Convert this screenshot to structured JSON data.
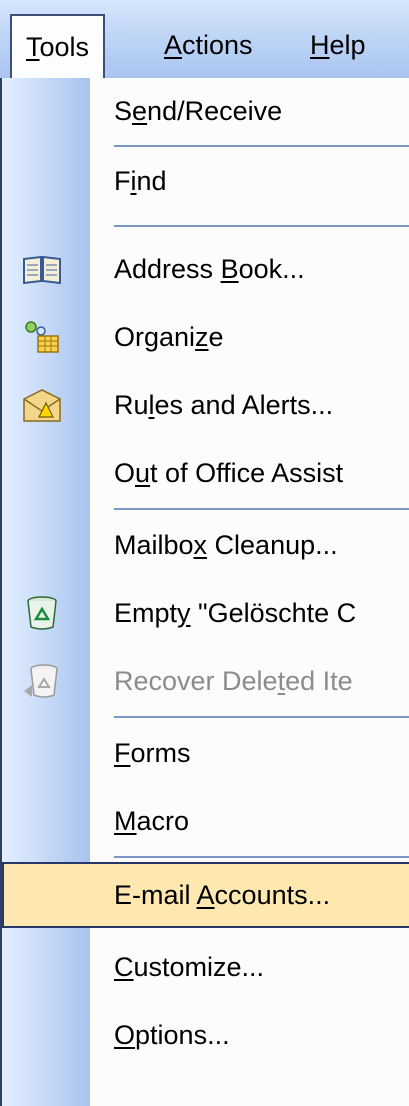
{
  "menubar": [
    {
      "pre": "",
      "u": "T",
      "post": "ools",
      "active": true
    },
    {
      "pre": "",
      "u": "A",
      "post": "ctions",
      "active": false
    },
    {
      "pre": "",
      "u": "H",
      "post": "elp",
      "active": false
    }
  ],
  "menu_items": [
    {
      "pre": "S",
      "u": "e",
      "post": "nd/Receive",
      "icon": null,
      "disabled": false,
      "highlight": false
    },
    {
      "pre": "F",
      "u": "i",
      "post": "nd",
      "icon": null,
      "disabled": false,
      "highlight": false
    },
    {
      "pre": "Address ",
      "u": "B",
      "post": "ook...",
      "icon": "address-book-icon",
      "disabled": false,
      "highlight": false
    },
    {
      "pre": "Organi",
      "u": "z",
      "post": "e",
      "icon": "organize-icon",
      "disabled": false,
      "highlight": false
    },
    {
      "pre": "Ru",
      "u": "l",
      "post": "es and Alerts...",
      "icon": "rules-and-alerts-icon",
      "disabled": false,
      "highlight": false
    },
    {
      "pre": "O",
      "u": "u",
      "post": "t of Office Assist",
      "icon": null,
      "disabled": false,
      "highlight": false
    },
    {
      "pre": "Mailbo",
      "u": "x",
      "post": " Cleanup...",
      "icon": null,
      "disabled": false,
      "highlight": false
    },
    {
      "pre": "Empt",
      "u": "y",
      "post": " \"Gelöschte C",
      "icon": "empty-trash-icon",
      "disabled": false,
      "highlight": false
    },
    {
      "pre": "Recover Dele",
      "u": "t",
      "post": "ed Ite",
      "icon": "recover-deleted-icon",
      "disabled": true,
      "highlight": false
    },
    {
      "pre": "",
      "u": "F",
      "post": "orms",
      "icon": null,
      "disabled": false,
      "highlight": false
    },
    {
      "pre": "",
      "u": "M",
      "post": "acro",
      "icon": null,
      "disabled": false,
      "highlight": false
    },
    {
      "pre": "E-mail ",
      "u": "A",
      "post": "ccounts...",
      "icon": null,
      "disabled": false,
      "highlight": true
    },
    {
      "pre": "",
      "u": "C",
      "post": "ustomize...",
      "icon": null,
      "disabled": false,
      "highlight": false
    },
    {
      "pre": "",
      "u": "O",
      "post": "ptions...",
      "icon": null,
      "disabled": false,
      "highlight": false
    }
  ],
  "colors": {
    "highlight_bg": "#ffe8b0",
    "gutter_edge": "#a9c3ee",
    "separator": "#7a95c6"
  }
}
